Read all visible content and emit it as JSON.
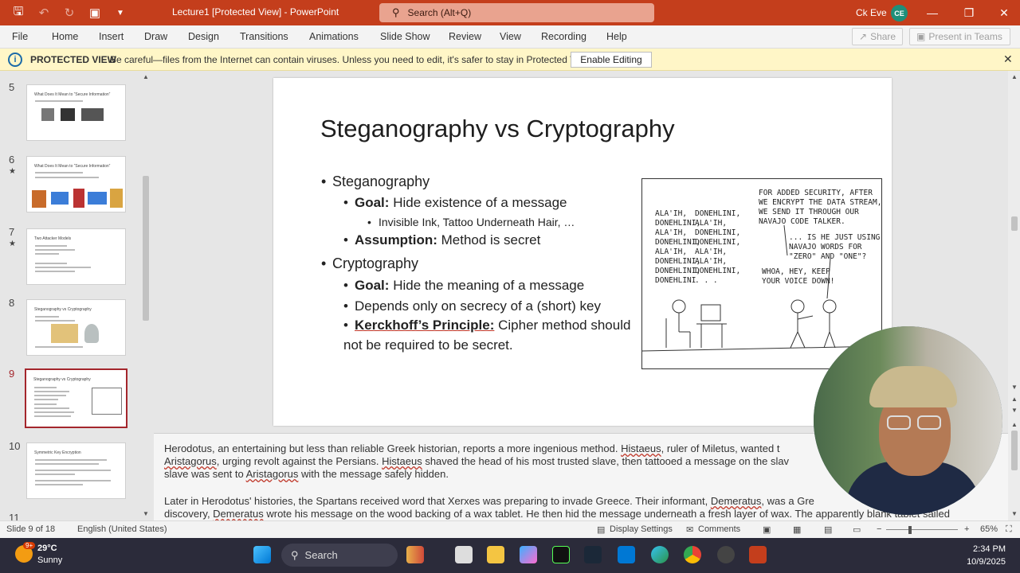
{
  "window": {
    "doc_title": "Lecture1 [Protected View]  -  PowerPoint",
    "search_placeholder": "Search (Alt+Q)",
    "user_name": "Ck Eve",
    "user_initials": "CE"
  },
  "ribbon": {
    "tabs": [
      "File",
      "Home",
      "Insert",
      "Draw",
      "Design",
      "Transitions",
      "Animations",
      "Slide Show",
      "Review",
      "View",
      "Recording",
      "Help"
    ],
    "share_label": "Share",
    "present_label": "Present in Teams"
  },
  "protected_view": {
    "label": "PROTECTED VIEW",
    "message": "Be careful—files from the Internet can contain viruses. Unless you need to edit, it's safer to stay in Protected View.",
    "enable_label": "Enable Editing"
  },
  "thumbnails": [
    {
      "num": "5",
      "title": "What Does It Mean to “Secure Information”",
      "star": false
    },
    {
      "num": "6",
      "title": "What Does It Mean to “Secure Information”",
      "star": true
    },
    {
      "num": "7",
      "title": "Two Attacker Models",
      "star": true
    },
    {
      "num": "8",
      "title": "Steganography vs Cryptography",
      "star": false
    },
    {
      "num": "9",
      "title": "Steganography vs Cryptography",
      "star": false
    },
    {
      "num": "10",
      "title": "Symmetric Key Encryption",
      "star": false
    },
    {
      "num": "11",
      "title": "",
      "star": false
    }
  ],
  "slide": {
    "title": "Steganography vs Cryptography",
    "bullets": {
      "steg": "Steganography",
      "steg_goal_label": "Goal:",
      "steg_goal_text": "Hide existence of a message",
      "steg_example": "Invisible Ink, Tattoo Underneath Hair, …",
      "steg_assumption_label": "Assumption:",
      "steg_assumption_text": "Method is secret",
      "crypto": "Cryptography",
      "crypto_goal_label": "Goal:",
      "crypto_goal_text": "Hide the meaning of a message",
      "crypto_depends": "Depends only on secrecy of a (short) key",
      "kerck_label": "Kerckhoff’s Principle:",
      "kerck_text": "Cipher method should",
      "kerck_text2": "not be required to be secret."
    },
    "comic": {
      "col1": "ALA'IH,\nDONEHLINI,\nALA'IH,\nDONEHLINI,\nALA'IH,\nDONEHLINI,\nDONEHLINI,\nDONEHLINI",
      "col2": "DONEHLINI,\nALA'IH,\nDONEHLINI,\nDONEHLINI,\nALA'IH,\nALA'IH,\nDONEHLINI,\n. . .",
      "caption1": "FOR ADDED SECURITY, AFTER\nWE ENCRYPT THE DATA STREAM,\nWE SEND IT THROUGH OUR\nNAVAJO CODE TALKER.",
      "caption2": "... IS HE JUST USING\nNAVAJO WORDS FOR\n\"ZERO\" AND \"ONE\"?",
      "caption3": "WHOA, HEY, KEEP\nYOUR VOICE DOWN!"
    }
  },
  "notes": {
    "line1a": "Herodotus, an entertaining but less than reliable Greek historian, reports a more ingenious method. ",
    "line1b": "Histaeus",
    "line1c": ", ruler of Miletus, wanted t",
    "line2a": "Aristagorus",
    "line2b": ", urging revolt against the Persians. ",
    "line2c": "Histaeus",
    "line2d": " shaved the head of his most trusted slave, then tattooed a message on the slav",
    "line3a": "slave was sent to ",
    "line3b": "Aristagorus",
    "line3c": " with the message safely hidden.",
    "line4a": "Later in Herodotus' histories, the Spartans received word that Xerxes was preparing to invade Greece. Their informant, ",
    "line4b": "Demeratus",
    "line4c": ", was a Gre",
    "line5a": "discovery, ",
    "line5b": "Demeratus",
    "line5c": " wrote his message on the wood backing of a wax tablet. He then hid the message underneath a fresh layer of wax. The apparently blank tablet sailed"
  },
  "status": {
    "slide_info": "Slide 9 of 18",
    "language": "English (United States)",
    "display_settings": "Display Settings",
    "comments": "Comments",
    "zoom": "65%"
  },
  "taskbar": {
    "temp": "29°C",
    "condition": "Sunny",
    "weather_badge": "9+",
    "search_label": "Search",
    "time": "2:34 PM",
    "date": "10/9/2025"
  },
  "colors": {
    "accent": "#c43e1c",
    "selected_thumb": "#a4262c",
    "protected_bg": "#fff6c7"
  }
}
